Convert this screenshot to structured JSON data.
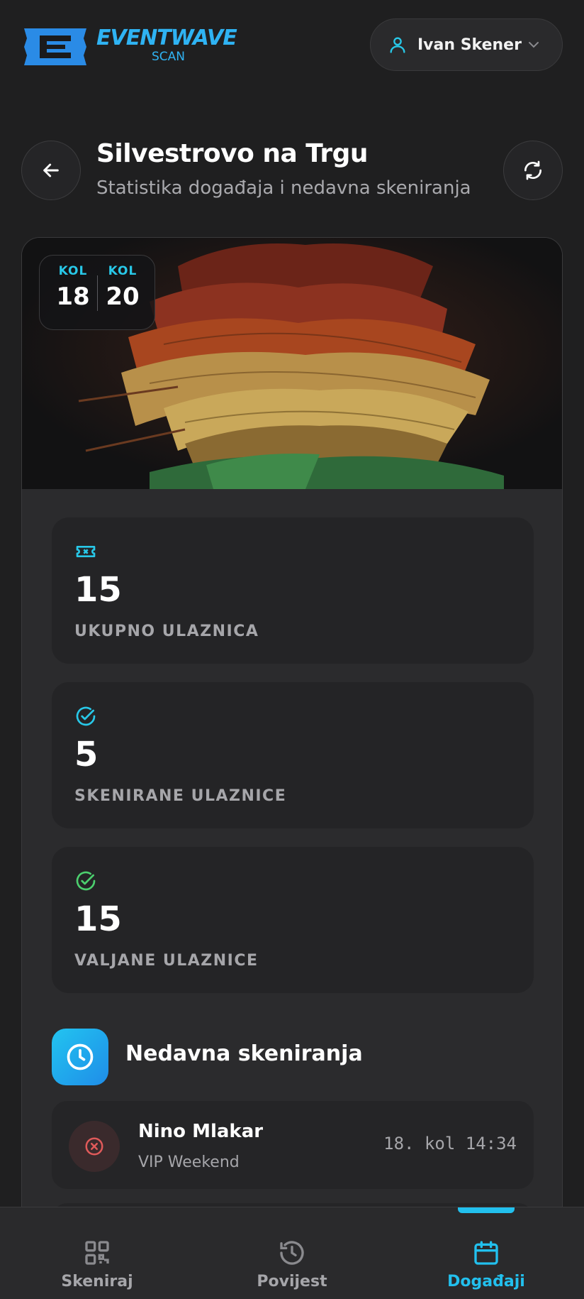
{
  "brand": {
    "name": "EVENTWAVE",
    "sub": "SCAN",
    "color": "#2fb3f3"
  },
  "user": {
    "name": "Ivan Skener",
    "icon": "user-icon"
  },
  "header": {
    "title": "Silvestrovo na Trgu",
    "subtitle": "Statistika događaja i nedavna skeniranja"
  },
  "event": {
    "date_start": {
      "month": "KOL",
      "day": "18"
    },
    "date_end": {
      "month": "KOL",
      "day": "20"
    }
  },
  "stats": [
    {
      "icon": "ticket-icon",
      "value": "15",
      "label": "UKUPNO ULAZNICA",
      "color": "#28c8e8"
    },
    {
      "icon": "check-circle-icon",
      "value": "5",
      "label": "SKENIRANE ULAZNICE",
      "color": "#28c8e8"
    },
    {
      "icon": "check-circle-icon",
      "value": "15",
      "label": "VALJANE ULAZNICE",
      "color": "#4ccf6e"
    }
  ],
  "recent": {
    "title": "Nedavna skeniranja",
    "items": [
      {
        "name": "Nino Mlakar",
        "ticket_type": "VIP Weekend",
        "time": "18. kol 14:34",
        "status": "invalid",
        "status_color": "#e05a5a"
      }
    ]
  },
  "nav": {
    "items": [
      {
        "label": "Skeniraj",
        "icon": "qr-code-icon",
        "active": false
      },
      {
        "label": "Povijest",
        "icon": "history-icon",
        "active": false
      },
      {
        "label": "Događaji",
        "icon": "calendar-icon",
        "active": true
      }
    ],
    "active_color": "#22c0ee",
    "inactive_color": "#a6a6aa"
  }
}
